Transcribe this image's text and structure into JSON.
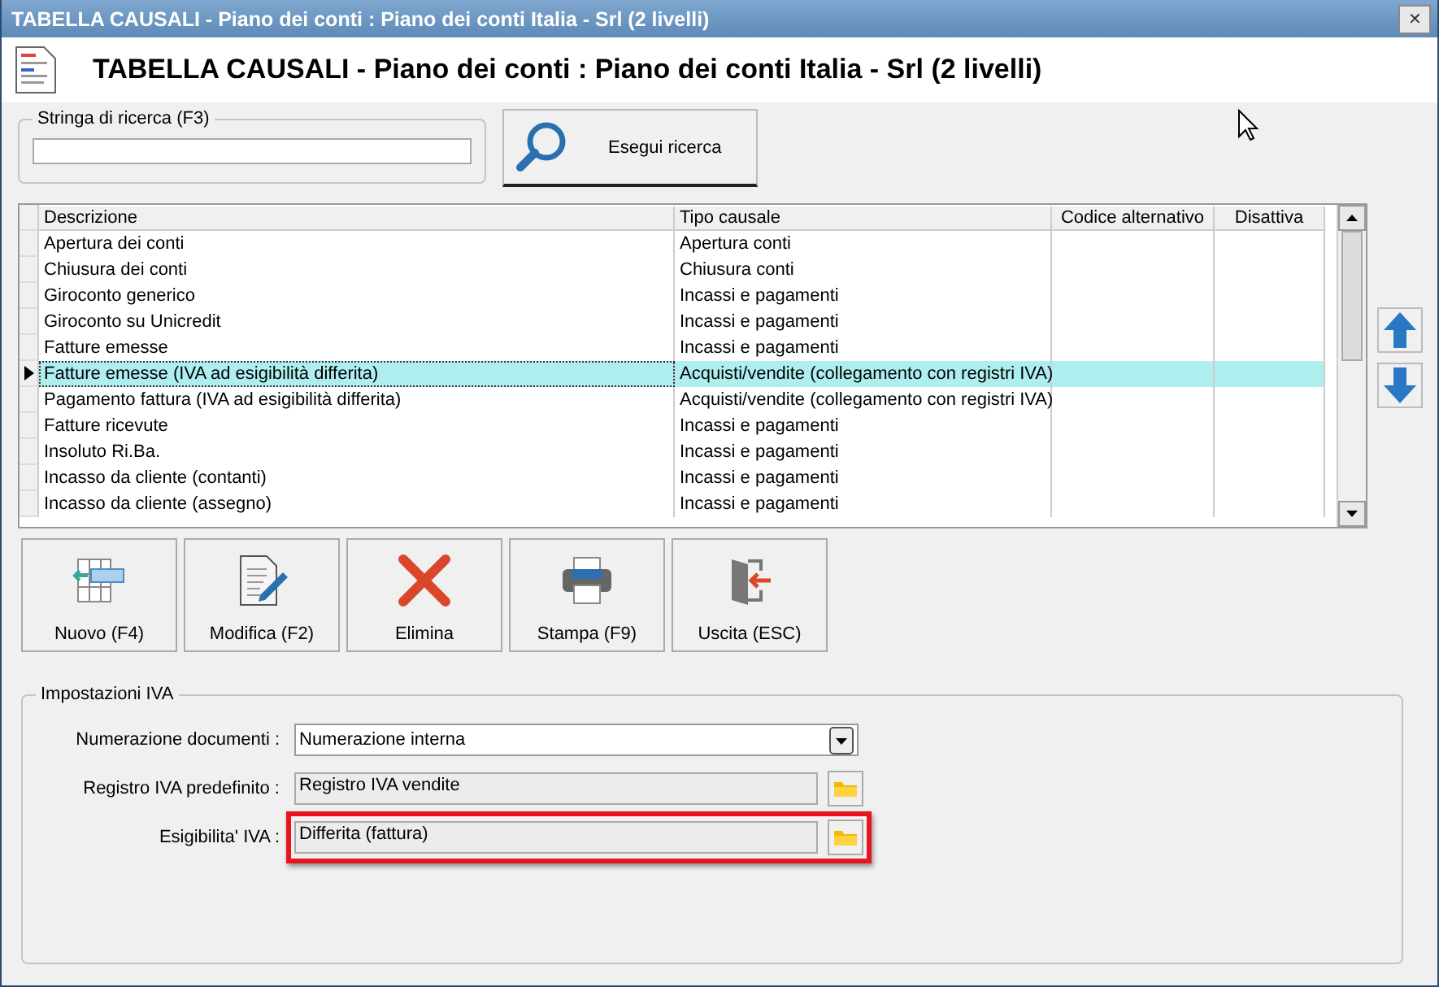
{
  "window": {
    "title": "TABELLA CAUSALI - Piano dei conti : Piano dei conti Italia - Srl (2 livelli)",
    "close": "✕"
  },
  "header": {
    "title": "TABELLA CAUSALI - Piano dei conti : Piano dei conti Italia - Srl (2 livelli)"
  },
  "search": {
    "group_label": "Stringa di ricerca (F3)",
    "button": "Esegui ricerca"
  },
  "table": {
    "columns": [
      "Descrizione",
      "Tipo causale",
      "Codice alternativo",
      "Disattiva"
    ],
    "rows": [
      {
        "cells": [
          "Apertura dei conti",
          "Apertura conti",
          "",
          ""
        ],
        "selected": false
      },
      {
        "cells": [
          "Chiusura dei conti",
          "Chiusura conti",
          "",
          ""
        ],
        "selected": false
      },
      {
        "cells": [
          "Giroconto generico",
          "Incassi e pagamenti",
          "",
          ""
        ],
        "selected": false
      },
      {
        "cells": [
          "Giroconto su Unicredit",
          "Incassi e pagamenti",
          "",
          ""
        ],
        "selected": false
      },
      {
        "cells": [
          "Fatture emesse",
          "Incassi e pagamenti",
          "",
          ""
        ],
        "selected": false
      },
      {
        "cells": [
          "Fatture emesse (IVA ad esigibilità differita)",
          "Acquisti/vendite (collegamento con registri IVA)",
          "",
          ""
        ],
        "selected": true
      },
      {
        "cells": [
          "Pagamento fattura (IVA ad esigibilità differita)",
          "Acquisti/vendite (collegamento con registri IVA)",
          "",
          ""
        ],
        "selected": false
      },
      {
        "cells": [
          "Fatture ricevute",
          "Incassi e pagamenti",
          "",
          ""
        ],
        "selected": false
      },
      {
        "cells": [
          "Insoluto Ri.Ba.",
          "Incassi e pagamenti",
          "",
          ""
        ],
        "selected": false
      },
      {
        "cells": [
          "Incasso da cliente (contanti)",
          "Incassi e pagamenti",
          "",
          ""
        ],
        "selected": false
      },
      {
        "cells": [
          "Incasso da cliente (assegno)",
          "Incassi e pagamenti",
          "",
          ""
        ],
        "selected": false
      }
    ]
  },
  "actions": [
    {
      "kind": "new",
      "label": "Nuovo (F4)"
    },
    {
      "kind": "edit",
      "label": "Modifica (F2)"
    },
    {
      "kind": "delete",
      "label": "Elimina"
    },
    {
      "kind": "print",
      "label": "Stampa (F9)"
    },
    {
      "kind": "exit",
      "label": "Uscita (ESC)"
    }
  ],
  "iva": {
    "group_label": "Impostazioni IVA",
    "fields": [
      {
        "kind": "dropdown",
        "label": "Numerazione documenti :",
        "value": "Numerazione interna",
        "highlighted": false
      },
      {
        "kind": "lookup",
        "label": "Registro IVA predefinito :",
        "value": "Registro IVA vendite",
        "highlighted": false
      },
      {
        "kind": "lookup",
        "label": "Esigibilita' IVA :",
        "value": "Differita (fattura)",
        "highlighted": true
      }
    ]
  }
}
